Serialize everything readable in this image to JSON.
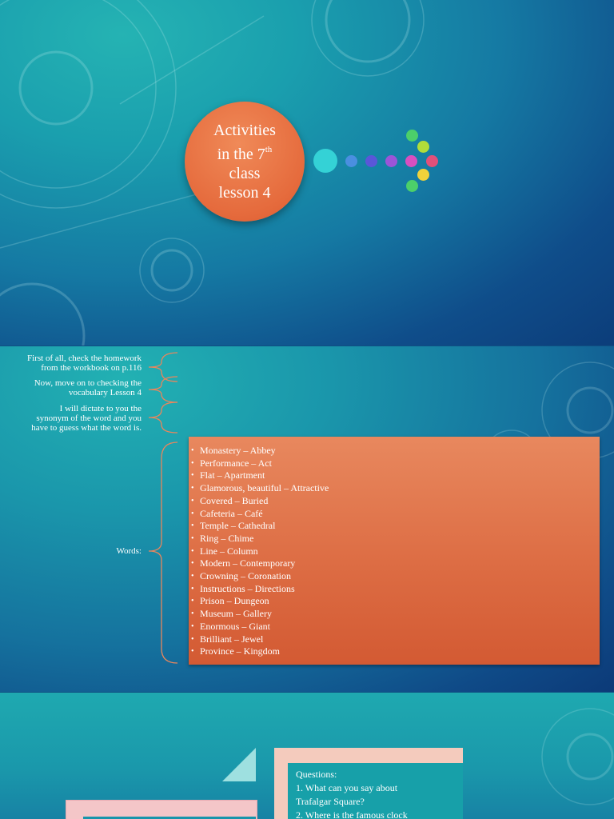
{
  "slide1": {
    "title_parts": {
      "line1": "Activities",
      "line2_prefix": "in the 7",
      "line2_sup": "th",
      "line3": "class",
      "line4": "lesson 4"
    },
    "accent": "#e56a3c",
    "dots": [
      "#34d2d6",
      "#4a8fe0",
      "#5a57d8",
      "#9b55d8",
      "#d84fc0",
      "#e2507a",
      "#f0d23a",
      "#96e04a",
      "#4ccf6a"
    ]
  },
  "slide2": {
    "instructions": [
      {
        "line1": "First of all, check the homework",
        "line2": "from the workbook on p.116"
      },
      {
        "line1": "Now, move on to checking the",
        "line2": "vocabulary Lesson 4"
      },
      {
        "line1": "I will dictate to you the",
        "line2": "synonym of the word and you",
        "line3": "have to guess what the word is."
      }
    ],
    "words_label": "Words:",
    "words": [
      "Monastery – Abbey",
      "Performance – Act",
      "Flat – Apartment",
      "Glamorous, beautiful – Attractive",
      "Covered – Buried",
      "Cafeteria – Café",
      "Temple – Cathedral",
      "Ring – Chime",
      "Line – Column",
      "Modern – Contemporary",
      "Crowning – Coronation",
      "Instructions – Directions",
      "Prison – Dungeon",
      "Museum – Gallery",
      "Enormous – Giant",
      "Brilliant – Jewel",
      "Province – Kingdom"
    ]
  },
  "slide3": {
    "questions_title": "Questions:",
    "q_lines": [
      "1. What can you say about",
      "Trafalgar Square?",
      "2. Where is the famous clock"
    ]
  }
}
